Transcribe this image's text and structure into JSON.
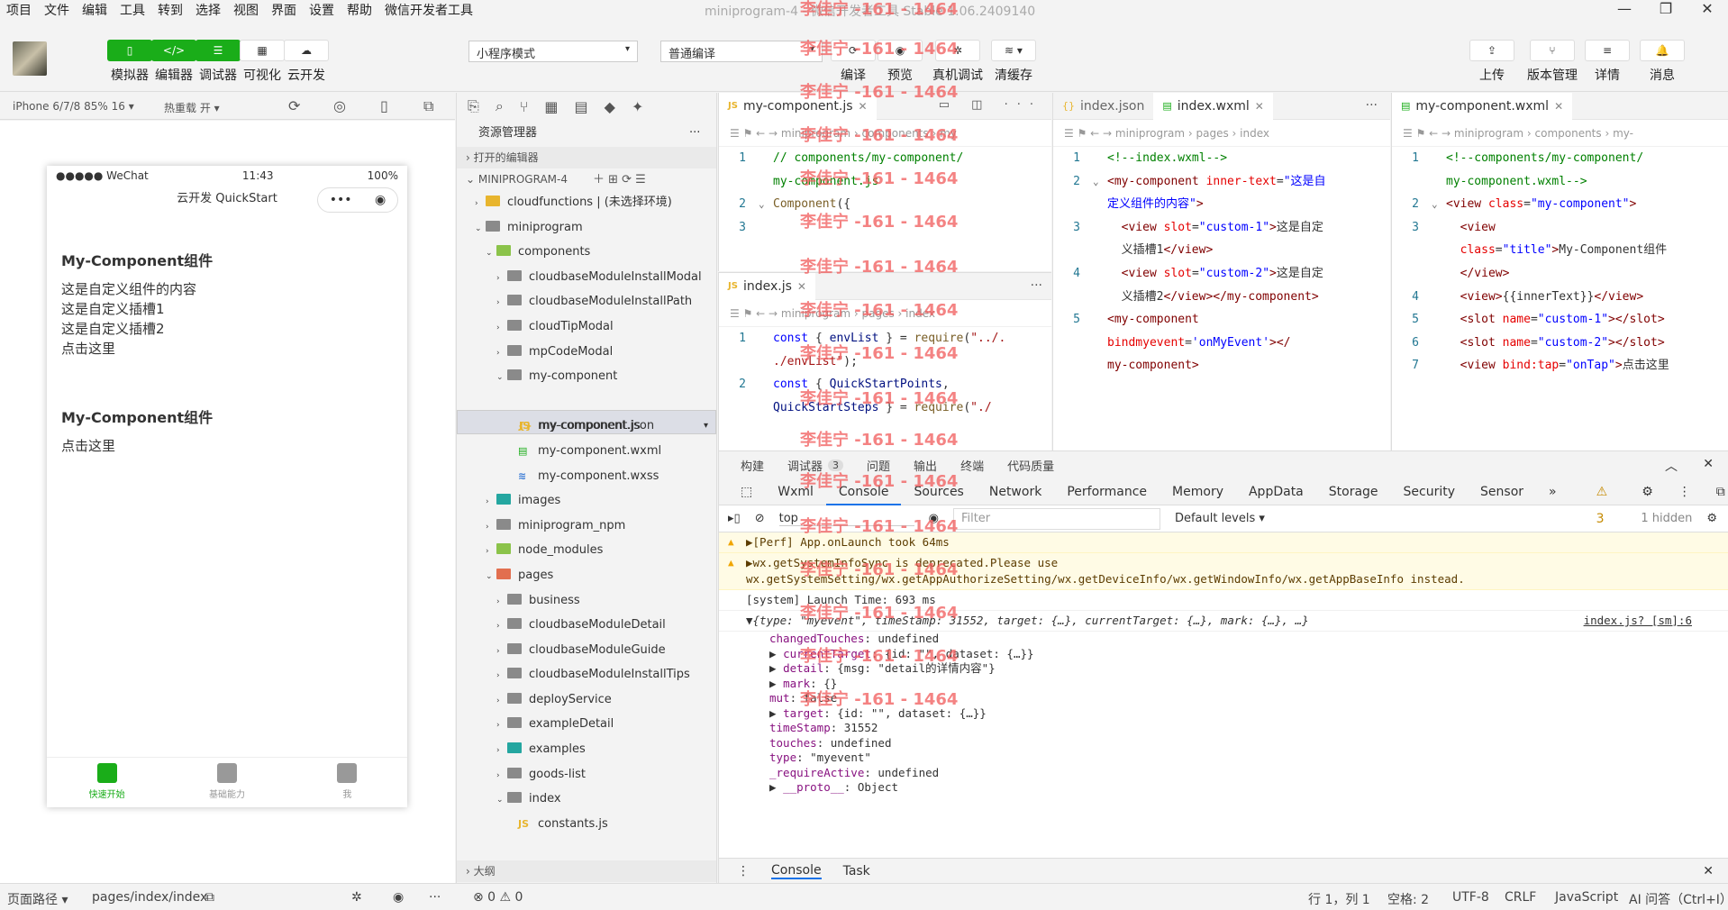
{
  "menu": [
    "项目",
    "文件",
    "编辑",
    "工具",
    "转到",
    "选择",
    "视图",
    "界面",
    "设置",
    "帮助",
    "微信开发者工具"
  ],
  "window_title": "miniprogram-4 - 微信开发者工具 Stable 1.06.2409140",
  "toolbar": {
    "simulator": "模拟器",
    "editor": "编辑器",
    "debugger": "调试器",
    "visual": "可视化",
    "cloud": "云开发",
    "mode": "小程序模式",
    "compile_mode": "普通编译",
    "compile": "编译",
    "preview": "预览",
    "remote_debug": "真机调试",
    "clear_cache": "清缓存",
    "upload": "上传",
    "version": "版本管理",
    "detail": "详情",
    "message": "消息"
  },
  "simulator": {
    "device": "iPhone 6/7/8 85% 16 ▾",
    "hot_reload": "热重载 开 ▾",
    "status_left": "●●●●● WeChat",
    "status_time": "11:43",
    "status_right": "100%",
    "nav_title": "云开发 QuickStart",
    "heading1": "My-Component组件",
    "lines1": [
      "这是自定义组件的内容",
      "这是自定义插槽1",
      "这是自定义插槽2",
      "点击这里"
    ],
    "heading2": "My-Component组件",
    "lines2": [
      "点击这里"
    ],
    "tabs": [
      "快速开始",
      "基础能力",
      "我"
    ]
  },
  "explorer": {
    "title": "资源管理器",
    "open_editors": "打开的编辑器",
    "project": "MINIPROGRAM-4",
    "tree": [
      {
        "name": "cloudfunctions | (未选择环境)",
        "depth": 1,
        "type": "fold y",
        "open": false
      },
      {
        "name": "miniprogram",
        "depth": 1,
        "type": "fold",
        "open": true
      },
      {
        "name": "components",
        "depth": 2,
        "type": "fold g",
        "open": true
      },
      {
        "name": "cloudbaseModuleInstallModal",
        "depth": 3,
        "type": "fold",
        "open": false
      },
      {
        "name": "cloudbaseModuleInstallPath",
        "depth": 3,
        "type": "fold",
        "open": false
      },
      {
        "name": "cloudTipModal",
        "depth": 3,
        "type": "fold",
        "open": false
      },
      {
        "name": "mpCodeModal",
        "depth": 3,
        "type": "fold",
        "open": false
      },
      {
        "name": "my-component",
        "depth": 3,
        "type": "fold",
        "open": true
      },
      {
        "name": "my-component.js",
        "depth": 4,
        "type": "js",
        "sel": true
      },
      {
        "name": "my-component.json",
        "depth": 4,
        "type": "json"
      },
      {
        "name": "my-component.wxml",
        "depth": 4,
        "type": "wxml"
      },
      {
        "name": "my-component.wxss",
        "depth": 4,
        "type": "wxss"
      },
      {
        "name": "images",
        "depth": 2,
        "type": "fold t",
        "open": false
      },
      {
        "name": "miniprogram_npm",
        "depth": 2,
        "type": "fold",
        "open": false
      },
      {
        "name": "node_modules",
        "depth": 2,
        "type": "fold g",
        "open": false
      },
      {
        "name": "pages",
        "depth": 2,
        "type": "fold r",
        "open": true
      },
      {
        "name": "business",
        "depth": 3,
        "type": "fold",
        "open": false
      },
      {
        "name": "cloudbaseModuleDetail",
        "depth": 3,
        "type": "fold",
        "open": false
      },
      {
        "name": "cloudbaseModuleGuide",
        "depth": 3,
        "type": "fold",
        "open": false
      },
      {
        "name": "cloudbaseModuleInstallTips",
        "depth": 3,
        "type": "fold",
        "open": false
      },
      {
        "name": "deployService",
        "depth": 3,
        "type": "fold",
        "open": false
      },
      {
        "name": "exampleDetail",
        "depth": 3,
        "type": "fold",
        "open": false
      },
      {
        "name": "examples",
        "depth": 3,
        "type": "fold t",
        "open": false
      },
      {
        "name": "goods-list",
        "depth": 3,
        "type": "fold",
        "open": false
      },
      {
        "name": "index",
        "depth": 3,
        "type": "fold",
        "open": true
      },
      {
        "name": "constants.js",
        "depth": 4,
        "type": "js"
      }
    ],
    "outline": "大纲"
  },
  "editor1": {
    "tab": "my-component.js",
    "crumb": "miniprogram › components › my",
    "lines": [
      {
        "n": "1",
        "html": "<span class='cm'>// components/my-component/</span>"
      },
      {
        "n": "",
        "html": "<span class='cm'>my-component.js</span>"
      },
      {
        "n": "2",
        "html": "<span class='fn'>Component</span>({"
      },
      {
        "n": "3",
        "html": ""
      }
    ]
  },
  "editor1b": {
    "tab": "index.js",
    "crumb": "miniprogram › pages › index",
    "lines": [
      {
        "n": "1",
        "html": "<span class='kw'>const</span> { <span class='vr'>envList</span> } = <span class='fn'>require</span>(<span class='st'>\"../.</span>"
      },
      {
        "n": "",
        "html": "<span class='st'>./envList\"</span>);"
      },
      {
        "n": "2",
        "html": "<span class='kw'>const</span> { <span class='vr'>QuickStartPoints</span>,"
      },
      {
        "n": "",
        "html": "<span class='vr'>QuickStartSteps</span> } = <span class='fn'>require</span>(<span class='st'>\"./</span>"
      }
    ]
  },
  "editor2": {
    "tab_a": "index.json",
    "tab_b": "index.wxml",
    "crumb": "miniprogram › pages › index",
    "lines": [
      {
        "n": "1",
        "html": "<span class='cm'>&lt;!--index.wxml--&gt;</span>"
      },
      {
        "n": "2",
        "html": "<span class='tg'>&lt;my-component</span> <span class='at'>inner-text</span>=<span class='kw'>\"这是自</span>"
      },
      {
        "n": "",
        "html": "<span class='kw'>定义组件的内容\"</span><span class='tg'>&gt;</span>"
      },
      {
        "n": "3",
        "html": "&nbsp;&nbsp;<span class='tg'>&lt;view</span> <span class='at'>slot</span>=<span class='kw'>\"custom-1\"</span><span class='tg'>&gt;</span>这是自定"
      },
      {
        "n": "",
        "html": "&nbsp;&nbsp;义插槽1<span class='tg'>&lt;/view&gt;</span>"
      },
      {
        "n": "4",
        "html": "&nbsp;&nbsp;<span class='tg'>&lt;view</span> <span class='at'>slot</span>=<span class='kw'>\"custom-2\"</span><span class='tg'>&gt;</span>这是自定"
      },
      {
        "n": "",
        "html": "&nbsp;&nbsp;义插槽2<span class='tg'>&lt;/view&gt;&lt;/my-component&gt;</span>"
      },
      {
        "n": "5",
        "html": "<span class='tg'>&lt;my-component</span>"
      },
      {
        "n": "",
        "html": "<span class='at'>bindmyevent</span>=<span class='kw'>'onMyEvent'</span><span class='tg'>&gt;&lt;/</span>"
      },
      {
        "n": "",
        "html": "<span class='tg'>my-component&gt;</span>"
      }
    ]
  },
  "editor3": {
    "tab": "my-component.wxml",
    "crumb": "miniprogram › components › my-",
    "lines": [
      {
        "n": "1",
        "html": "<span class='cm'>&lt;!--components/my-component/</span>"
      },
      {
        "n": "",
        "html": "<span class='cm'>my-component.wxml--&gt;</span>"
      },
      {
        "n": "2",
        "html": "<span class='tg'>&lt;view</span> <span class='at'>class</span>=<span class='kw'>\"my-component\"</span><span class='tg'>&gt;</span>"
      },
      {
        "n": "3",
        "html": "&nbsp;&nbsp;<span class='tg'>&lt;view</span>"
      },
      {
        "n": "",
        "html": "&nbsp;&nbsp;<span class='at'>class</span>=<span class='kw'>\"title\"</span><span class='tg'>&gt;</span>My-Component组件"
      },
      {
        "n": "",
        "html": "&nbsp;&nbsp;<span class='tg'>&lt;/view&gt;</span>"
      },
      {
        "n": "4",
        "html": "&nbsp;&nbsp;<span class='tg'>&lt;view&gt;</span>{{innerText}}<span class='tg'>&lt;/view&gt;</span>"
      },
      {
        "n": "5",
        "html": "&nbsp;&nbsp;<span class='tg'>&lt;slot</span> <span class='at'>name</span>=<span class='kw'>\"custom-1\"</span><span class='tg'>&gt;&lt;/slot&gt;</span>"
      },
      {
        "n": "6",
        "html": "&nbsp;&nbsp;<span class='tg'>&lt;slot</span> <span class='at'>name</span>=<span class='kw'>\"custom-2\"</span><span class='tg'>&gt;&lt;/slot&gt;</span>"
      },
      {
        "n": "7",
        "html": "&nbsp;&nbsp;<span class='tg'>&lt;view</span> <span class='at'>bind:tap</span>=<span class='kw'>\"onTap\"</span><span class='tg'>&gt;</span>点击这里"
      }
    ]
  },
  "debug": {
    "top_tabs": [
      "构建",
      "调试器",
      "问题",
      "输出",
      "终端",
      "代码质量"
    ],
    "debugger_badge": "3",
    "dev_tabs": [
      "Wxml",
      "Console",
      "Sources",
      "Network",
      "Performance",
      "Memory",
      "AppData",
      "Storage",
      "Security",
      "Sensor"
    ],
    "warn_count": "3",
    "context": "top",
    "filter_placeholder": "Filter",
    "levels": "Default levels ▾",
    "hidden": "1 hidden",
    "console": [
      {
        "type": "warn",
        "text": "▶[Perf] App.onLaunch took 64ms"
      },
      {
        "type": "warn",
        "text": "▶wx.getSystemInfoSync is deprecated.Please use wx.getSystemSetting/wx.getAppAuthorizeSetting/wx.getDeviceInfo/wx.getWindowInfo/wx.getAppBaseInfo instead."
      },
      {
        "type": "log",
        "text": "[system] Launch Time: 693 ms"
      }
    ],
    "object_head": "▼{type: \"myevent\", timeStamp: 31552, target: {…}, currentTarget: {…}, mark: {…}, …}",
    "object_src": "index.js? [sm]:6",
    "props": [
      {
        "k": "changedTouches",
        "v": ": undefined",
        "a": ""
      },
      {
        "k": "currentTarget",
        "v": ": {id: \"\", dataset: {…}}",
        "a": "▶ "
      },
      {
        "k": "detail",
        "v": ": {msg: \"detail的详情内容\"}",
        "a": "▶ "
      },
      {
        "k": "mark",
        "v": ": {}",
        "a": "▶ "
      },
      {
        "k": "mut",
        "v": ": false",
        "a": ""
      },
      {
        "k": "target",
        "v": ": {id: \"\", dataset: {…}}",
        "a": "▶ "
      },
      {
        "k": "timeStamp",
        "v": ": 31552",
        "a": ""
      },
      {
        "k": "touches",
        "v": ": undefined",
        "a": ""
      },
      {
        "k": "type",
        "v": ": \"myevent\"",
        "a": ""
      },
      {
        "k": "_requireActive",
        "v": ": undefined",
        "a": ""
      },
      {
        "k": "__proto__",
        "v": ": Object",
        "a": "▶ "
      }
    ],
    "bottom_tabs": [
      "Console",
      "Task"
    ]
  },
  "status": {
    "path": "页面路径 ▾",
    "page": "pages/index/index",
    "errors": "⊗ 0 ⚠ 0",
    "pos": "行 1，列 1",
    "spaces": "空格: 2",
    "enc": "UTF-8",
    "eol": "CRLF",
    "lang": "JavaScript",
    "ai": "AI 问答（Ctrl+I）"
  },
  "watermark": "李佳宁 -161 - 1464"
}
